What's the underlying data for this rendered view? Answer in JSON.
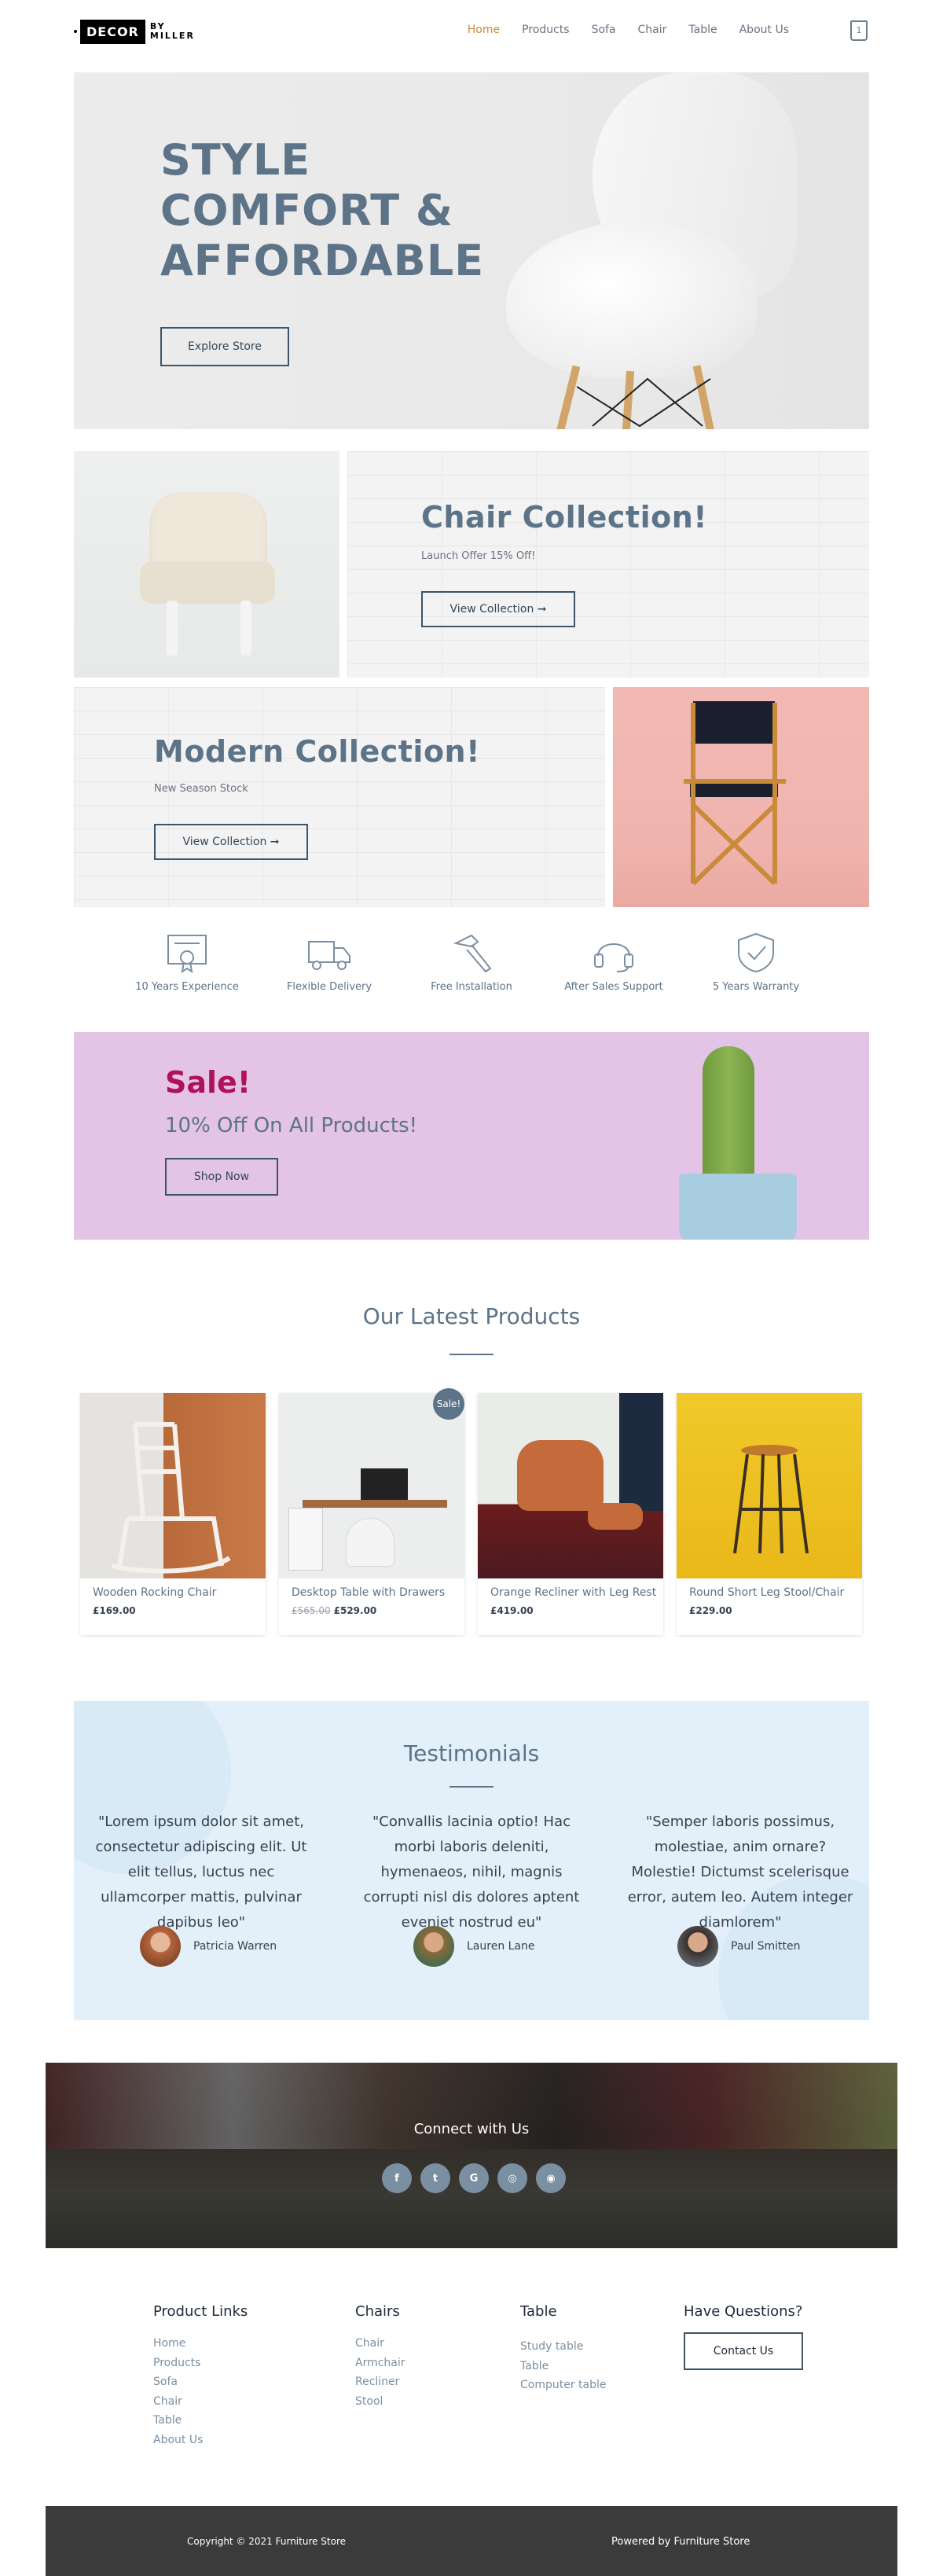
{
  "header": {
    "logo_main": "DECOR",
    "logo_top": "BY",
    "logo_bottom": "MILLER",
    "nav": [
      "Home",
      "Products",
      "Sofa",
      "Chair",
      "Table",
      "About Us"
    ],
    "cart_count": "1",
    "accent": "#c98b3a"
  },
  "hero": {
    "title_lines": [
      "STYLE",
      "COMFORT &",
      "AFFORDABLE"
    ],
    "button": "Explore Store"
  },
  "collections": [
    {
      "title": "Chair Collection!",
      "subtitle": "Launch Offer 15% Off!",
      "button": "View Collection ➞"
    },
    {
      "title": "Modern Collection!",
      "subtitle": "New Season Stock",
      "button": "View Collection ➞"
    }
  ],
  "features": [
    {
      "label": "10 Years Experience",
      "icon": "certificate-icon"
    },
    {
      "label": "Flexible Delivery",
      "icon": "truck-icon"
    },
    {
      "label": "Free Installation",
      "icon": "hammer-icon"
    },
    {
      "label": "After Sales Support",
      "icon": "headset-icon"
    },
    {
      "label": "5 Years Warranty",
      "icon": "shield-check-icon"
    }
  ],
  "sale": {
    "title": "Sale!",
    "subtitle": "10% Off On All Products!",
    "button": "Shop Now",
    "title_color": "#b0125a"
  },
  "products": {
    "title": "Our Latest Products",
    "items": [
      {
        "name": "Wooden Rocking Chair",
        "price": "£169.00",
        "old_price": ""
      },
      {
        "name": "Desktop Table with Drawers",
        "price": "£529.00",
        "old_price": "£565.00",
        "badge": "Sale!"
      },
      {
        "name": "Orange Recliner with Leg Rest",
        "price": "£419.00",
        "old_price": ""
      },
      {
        "name": "Round Short Leg Stool/Chair",
        "price": "£229.00",
        "old_price": ""
      }
    ]
  },
  "testimonials": {
    "title": "Testimonials",
    "items": [
      {
        "quote": "\"Lorem ipsum dolor sit amet, consectetur adipiscing elit. Ut elit tellus, luctus nec ullamcorper mattis, pulvinar dapibus leo\"",
        "name": "Patricia Warren"
      },
      {
        "quote": "\"Convallis lacinia optio! Hac morbi laboris deleniti, hymenaeos, nihil, magnis corrupti nisl dis dolores aptent eveniet nostrud eu\"",
        "name": "Lauren Lane"
      },
      {
        "quote": "\"Semper laboris possimus, molestiae, anim ornare? Molestie! Dictumst scelerisque error, autem leo. Autem integer diamlorem\"",
        "name": "Paul Smitten"
      }
    ]
  },
  "connect": {
    "title": "Connect with Us",
    "socials": [
      {
        "icon": "facebook-icon",
        "glyph": "f"
      },
      {
        "icon": "twitter-icon",
        "glyph": "t"
      },
      {
        "icon": "google-icon",
        "glyph": "G"
      },
      {
        "icon": "instagram-icon",
        "glyph": "◎"
      },
      {
        "icon": "dribbble-icon",
        "glyph": "◉"
      }
    ]
  },
  "footer": {
    "product_links": {
      "title": "Product Links",
      "links": [
        "Home",
        "Products",
        "Sofa",
        "Chair",
        "Table",
        "About Us"
      ]
    },
    "chairs": {
      "title": "Chairs",
      "links": [
        "Chair",
        "Armchair",
        "Recliner",
        "Stool"
      ]
    },
    "table": {
      "title": "Table",
      "links": [
        "Study table",
        "Table",
        "Computer table"
      ]
    },
    "questions": {
      "title": "Have Questions?",
      "button": "Contact Us"
    },
    "copyright": "Copyright © 2021 Furniture Store",
    "powered": "Powered by Furniture Store"
  }
}
